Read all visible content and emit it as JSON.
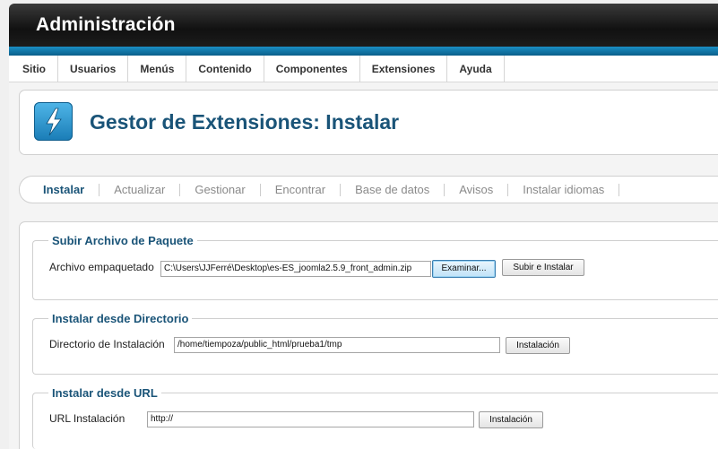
{
  "header": {
    "title": "Administración"
  },
  "menu": {
    "items": [
      {
        "label": "Sitio"
      },
      {
        "label": "Usuarios"
      },
      {
        "label": "Menús"
      },
      {
        "label": "Contenido"
      },
      {
        "label": "Componentes"
      },
      {
        "label": "Extensiones"
      },
      {
        "label": "Ayuda"
      }
    ]
  },
  "page": {
    "title": "Gestor de Extensiones: Instalar",
    "icon": "bolt-icon",
    "accent": "#1a5478"
  },
  "subnav": {
    "tabs": [
      {
        "label": "Instalar",
        "active": true
      },
      {
        "label": "Actualizar"
      },
      {
        "label": "Gestionar"
      },
      {
        "label": "Encontrar"
      },
      {
        "label": "Base de datos"
      },
      {
        "label": "Avisos"
      },
      {
        "label": "Instalar idiomas"
      }
    ]
  },
  "upload": {
    "legend": "Subir Archivo de Paquete",
    "label": "Archivo empaquetado",
    "file_value": "C:\\Users\\JJFerré\\Desktop\\es-ES_joomla2.5.9_front_admin.zip",
    "browse_label": "Examinar...",
    "submit_label": "Subir e Instalar"
  },
  "directory": {
    "legend": "Instalar desde Directorio",
    "label": "Directorio de Instalación",
    "value": "/home/tiempoza/public_html/prueba1/tmp",
    "button_label": "Instalación"
  },
  "url": {
    "legend": "Instalar desde URL",
    "label": "URL Instalación",
    "value": "http://",
    "button_label": "Instalación"
  }
}
